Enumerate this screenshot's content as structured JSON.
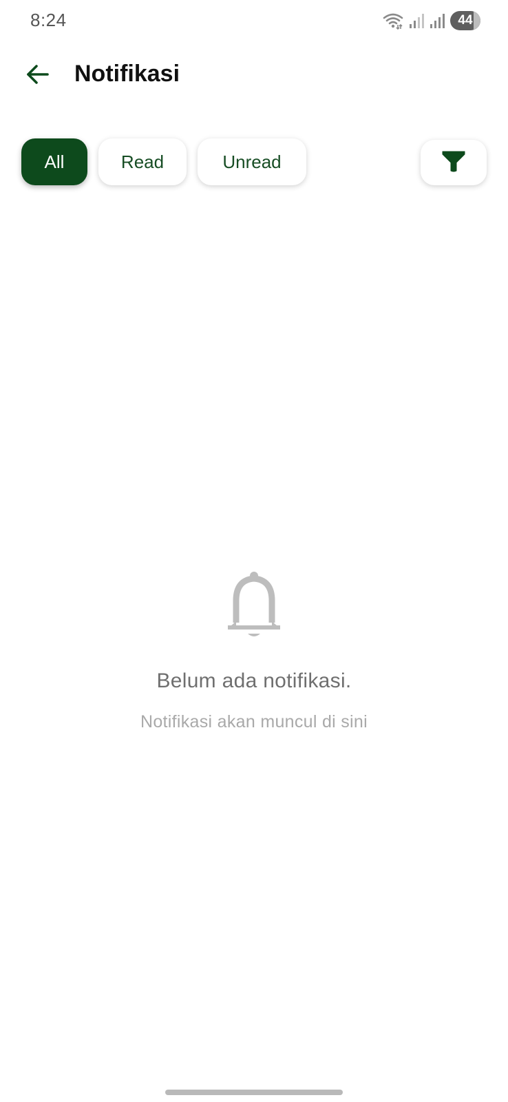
{
  "status_bar": {
    "time": "8:24",
    "battery": "44",
    "icons": [
      "wifi-icon",
      "signal-icon",
      "signal-icon",
      "battery-icon"
    ]
  },
  "header": {
    "title": "Notifikasi",
    "back_icon": "arrow-left-icon"
  },
  "filters": {
    "chips": [
      {
        "label": "All",
        "selected": true
      },
      {
        "label": "Read",
        "selected": false
      },
      {
        "label": "Unread",
        "selected": false
      }
    ],
    "filter_icon": "funnel-icon"
  },
  "empty_state": {
    "icon": "bell-icon",
    "title": "Belum ada notifikasi.",
    "subtitle": "Notifikasi akan muncul di sini"
  },
  "colors": {
    "primary": "#0d4a1c",
    "chip_text": "#174d24",
    "muted_text": "#6f6f6f",
    "faint_text": "#a9a9a9",
    "icon_gray": "#bdbdbd"
  }
}
